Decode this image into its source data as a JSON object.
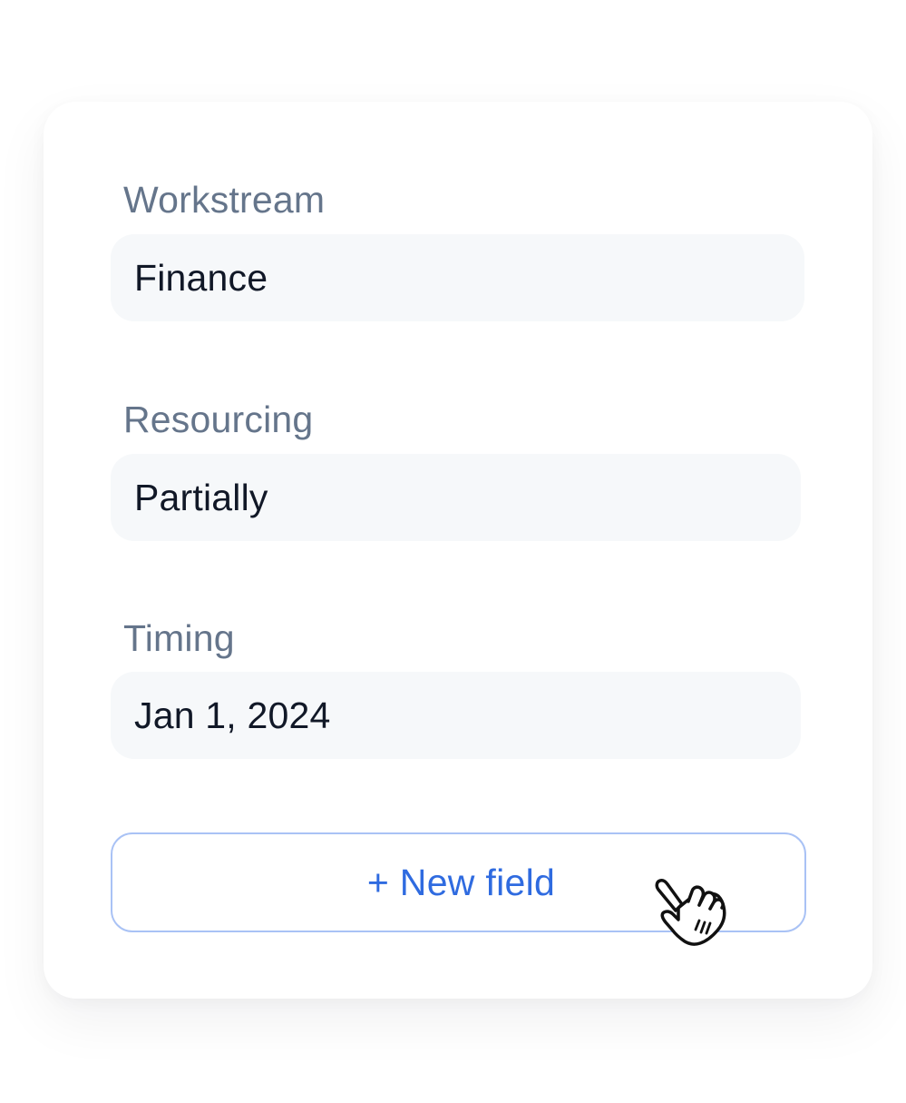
{
  "fields": [
    {
      "label": "Workstream",
      "value": "Finance"
    },
    {
      "label": "Resourcing",
      "value": "Partially"
    },
    {
      "label": "Timing",
      "value": "Jan 1, 2024"
    }
  ],
  "new_field_button": {
    "label": "+ New field"
  },
  "cursor": {
    "icon": "hand-pointer-icon"
  },
  "colors": {
    "label_text": "#65758b",
    "value_text": "#111827",
    "field_background": "#f6f8fa",
    "button_border": "#a9c2f5",
    "button_text": "#2f6be0"
  }
}
